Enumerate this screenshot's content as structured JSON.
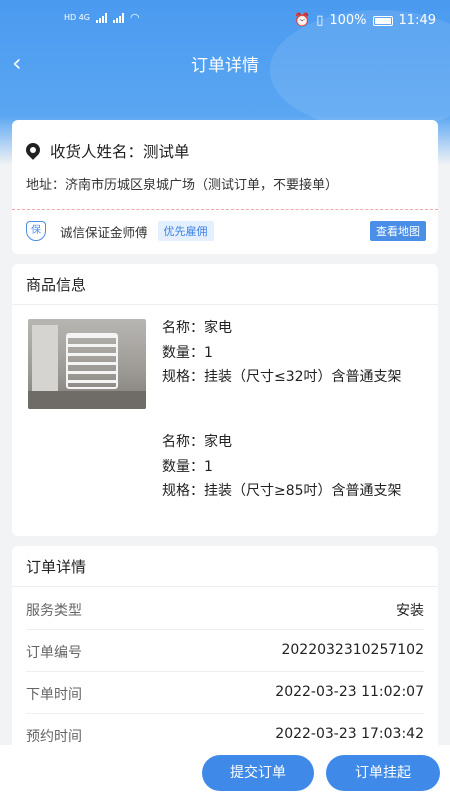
{
  "status_bar": {
    "network_left": "HD 4G",
    "battery": "100%",
    "time": "11:49"
  },
  "nav": {
    "title": "订单详情"
  },
  "address": {
    "receiver": "收货人姓名：测试单",
    "address": "地址：济南市历城区泉城广场（测试订单，不要接单）",
    "shield_glyph": "保",
    "master": "诚信保证金师傅",
    "tag": "优先雇佣",
    "map_button": "查看地图"
  },
  "goods": {
    "title": "商品信息",
    "items": [
      {
        "name": "名称：家电",
        "qty": "数量：1",
        "spec": "规格：挂装（尺寸≤32吋）含普通支架"
      },
      {
        "name": "名称：家电",
        "qty": "数量：1",
        "spec": "规格：挂装（尺寸≥85吋）含普通支架"
      }
    ]
  },
  "details": {
    "title": "订单详情",
    "rows": [
      {
        "key": "服务类型",
        "value": "安装"
      },
      {
        "key": "订单编号",
        "value": "2022032310257102"
      },
      {
        "key": "下单时间",
        "value": "2022-03-23 11:02:07"
      },
      {
        "key": "预约时间",
        "value": "2022-03-23 17:03:42"
      }
    ]
  },
  "actions": {
    "submit": "提交订单",
    "hold": "订单挂起"
  },
  "colors": {
    "header_blue": "#4a9af0",
    "accent": "#3f8ae8"
  }
}
